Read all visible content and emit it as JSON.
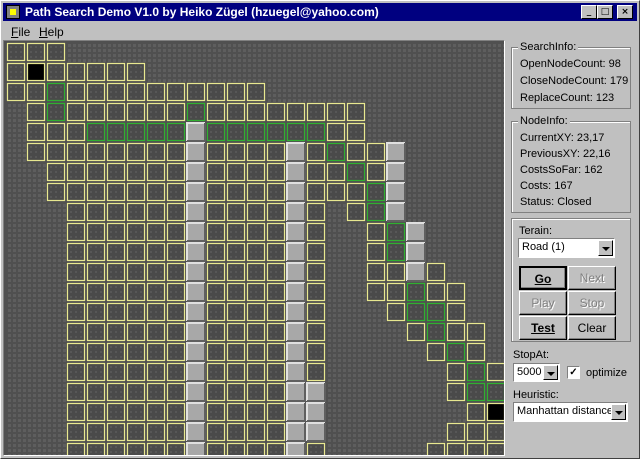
{
  "window": {
    "title": "Path Search Demo V1.0 by Heiko Zügel (hzuegel@yahoo.com)",
    "controls": {
      "minimize": "_",
      "maximize": "□",
      "close": "×"
    }
  },
  "menu": [
    {
      "label": "File",
      "key": "F",
      "rest": "ile"
    },
    {
      "label": "Help",
      "key": "H",
      "rest": "elp"
    }
  ],
  "search_info": {
    "title": "SearchInfo:",
    "rows": [
      "OpenNodeCount: 98",
      "CloseNodeCount: 179",
      "ReplaceCount: 123"
    ]
  },
  "node_info": {
    "title": "NodeInfo:",
    "rows": [
      "CurrentXY: 23,17",
      "PreviousXY: 22,16",
      "CostsSoFar: 162",
      "Costs: 167",
      "Status: Closed"
    ]
  },
  "controls": {
    "terrain_label": "Terain:",
    "terrain_value": "Road (1)",
    "go": "Go",
    "next": "Next",
    "play": "Play",
    "stop": "Stop",
    "test": "Test",
    "clear": "Clear",
    "stopat_label": "StopAt:",
    "stopat_value": "5000",
    "optimize_label": "optimize",
    "optimize_checked": "✓",
    "heuristic_label": "Heuristic:",
    "heuristic_value": "Manhattan distance"
  },
  "grid": {
    "cols": 25,
    "rows": 21,
    "legend": {
      ".": "road",
      "Y": "closed-node",
      "G": "open-node",
      "W": "wall",
      "S": "start",
      "E": "goal"
    },
    "map": [
      "YYY......................",
      "YSYYYYY..................",
      "YYGYYYYYYYYYY............",
      ".YGYYYYYYGYYYYYYYY.......",
      ".YYYGGGGGWGGGGGGYY.......",
      ".YYYYYYYYWYYYYWYGYYW.....",
      "..YYYYYYYWYYYYWYYGYW.....",
      "..YYYYYYYWYYYYWYYYGW.....",
      "...YYYYYYWYYYYWY.YGW.....",
      "...YYYYYYWYYYYWY..YGW....",
      "...YYYYYYWYYYYWY..YGW....",
      "...YYYYYYWYYYYWY..YYWY...",
      "...YYYYYYWYYYYWY..YYGYY..",
      "...YYYYYYWYYYYWY...YGGY..",
      "...YYYYYYWYYYYWY....YGYY.",
      "...YYYYYYWYYYYWY.....YGY.",
      "...YYYYYYWYYYYWY......YGY",
      "...YYYYYYWYYYYWW......YGG",
      "...YYYYYYWYYYYWW.......YE",
      "...YYYYYYWYYYYWW......YYY",
      "...YYYYYYWYYYYWY.....YYYY"
    ]
  },
  "colors": {
    "closed": "#e8e890",
    "open": "#30b030",
    "wall_face": "#a8a8a8",
    "cell_fill": "#4a4a4a",
    "cell_fill_hi": "#434343",
    "road_bg": "#505050",
    "start_goal": "#000000"
  }
}
